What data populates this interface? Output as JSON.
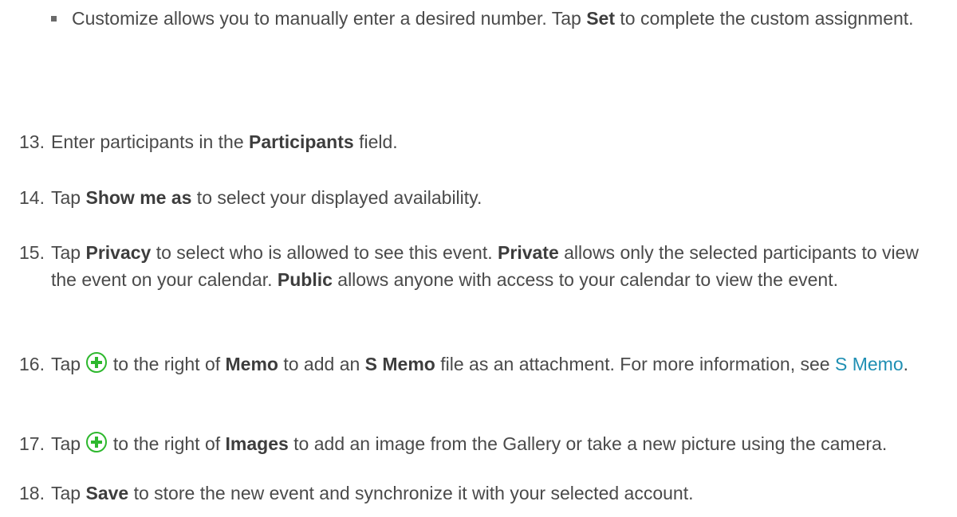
{
  "bullet": {
    "text_before": "Customize allows you to manually enter a desired number. Tap ",
    "bold": "Set",
    "text_after": " to complete the custom assignment."
  },
  "steps": [
    {
      "num": "13.",
      "parts": [
        "Enter participants in the ",
        "Participants",
        " field."
      ]
    },
    {
      "num": "14.",
      "parts": [
        "Tap ",
        "Show me as",
        " to select your displayed availability."
      ]
    },
    {
      "num": "15.",
      "parts": [
        "Tap ",
        "Privacy",
        " to select who is allowed to see this event. ",
        "Private",
        " allows only the selected participants to view the event on your calendar. ",
        "Public",
        " allows anyone with access to your calendar to view the event."
      ]
    },
    {
      "num": "16.",
      "parts": [
        "Tap ",
        " to the right of ",
        "Memo",
        " to add an ",
        "S Memo",
        " file as an attachment. For more information, see ",
        "S Memo",
        "."
      ]
    },
    {
      "num": "17.",
      "parts": [
        "Tap ",
        " to the right of ",
        "Images",
        " to add an image from the Gallery or take a new picture using the camera."
      ]
    },
    {
      "num": "18.",
      "parts": [
        "Tap ",
        "Save",
        " to store the new event and synchronize it with your selected account."
      ]
    }
  ],
  "icons": {
    "add": "plus-circle-icon",
    "add_color": "#2eb82e"
  },
  "colors": {
    "text": "#4a4a4a",
    "link": "#1f8fb3"
  }
}
